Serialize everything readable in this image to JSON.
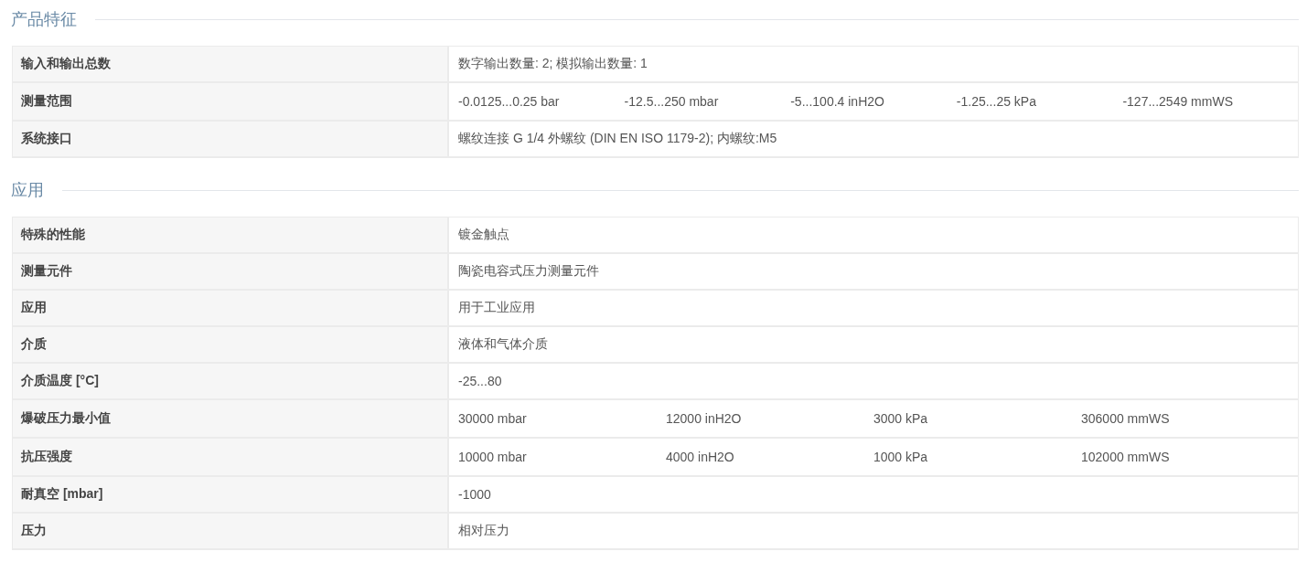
{
  "sections": [
    {
      "title": "产品特征",
      "rows": [
        {
          "label": "输入和输出总数",
          "values": [
            "数字输出数量: 2; 模拟输出数量: 1"
          ]
        },
        {
          "label": "测量范围",
          "values": [
            "-0.0125...0.25 bar",
            "-12.5...250 mbar",
            "-5...100.4 inH2O",
            "-1.25...25 kPa",
            "-127...2549 mmWS"
          ]
        },
        {
          "label": "系统接口",
          "values": [
            "螺纹连接 G 1/4 外螺纹 (DIN EN ISO 1179-2); 内螺纹:M5"
          ]
        }
      ]
    },
    {
      "title": "应用",
      "rows": [
        {
          "label": "特殊的性能",
          "values": [
            "镀金触点"
          ]
        },
        {
          "label": "测量元件",
          "values": [
            "陶瓷电容式压力测量元件"
          ]
        },
        {
          "label": "应用",
          "values": [
            "用于工业应用"
          ]
        },
        {
          "label": "介质",
          "values": [
            "液体和气体介质"
          ]
        },
        {
          "label": "介质温度 [°C]",
          "values": [
            "-25...80"
          ]
        },
        {
          "label": "爆破压力最小值",
          "values": [
            "30000 mbar",
            "12000 inH2O",
            "3000 kPa",
            "306000 mmWS"
          ]
        },
        {
          "label": "抗压强度",
          "values": [
            "10000 mbar",
            "4000 inH2O",
            "1000 kPa",
            "102000 mmWS"
          ]
        },
        {
          "label": "耐真空 [mbar]",
          "values": [
            "-1000"
          ]
        },
        {
          "label": "压力",
          "values": [
            "相对压力"
          ]
        }
      ]
    }
  ]
}
